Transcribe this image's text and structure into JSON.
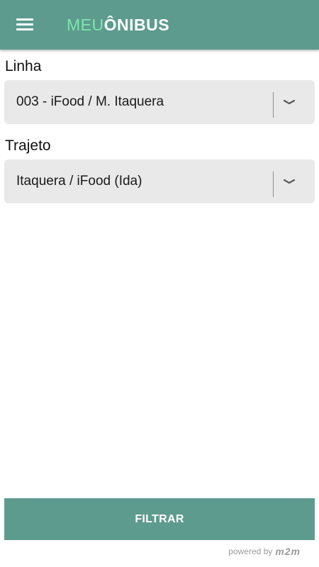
{
  "header": {
    "logo_part1": "MEU",
    "logo_part2": "ÔNIBUS",
    "accent_color": "#5e9b8f",
    "logo_highlight_color": "#7ce6a8",
    "menu_icon": "hamburger-menu-icon"
  },
  "form": {
    "linha": {
      "label": "Linha",
      "value": "003 - iFood / M. Itaquera",
      "icon": "chevron-down-icon"
    },
    "trajeto": {
      "label": "Trajeto",
      "value": "Itaquera / iFood (Ida)",
      "icon": "chevron-down-icon"
    }
  },
  "actions": {
    "filter_label": "FILTRAR"
  },
  "footer": {
    "powered_by": "powered by",
    "brand": "m2m"
  }
}
